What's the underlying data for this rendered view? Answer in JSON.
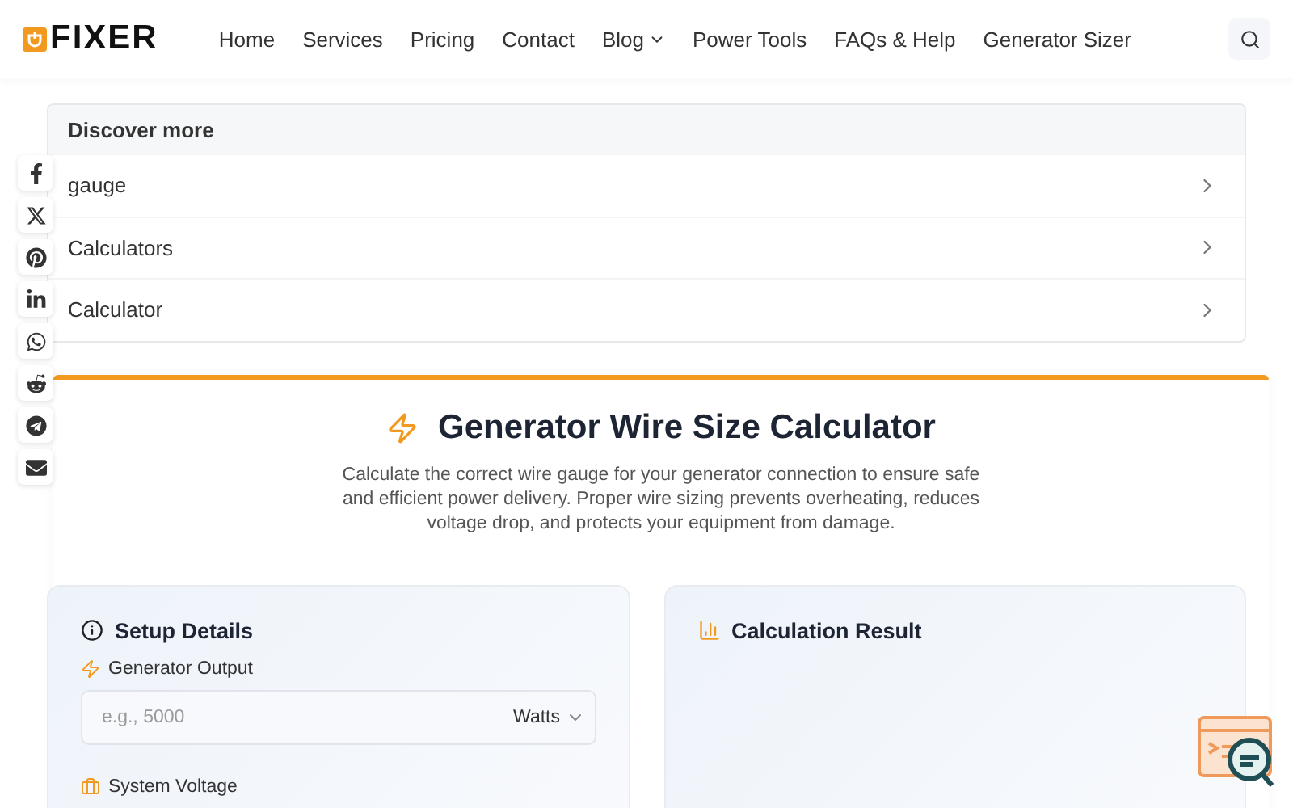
{
  "logo": {
    "text": "FIXER"
  },
  "nav": [
    {
      "label": "Home",
      "has_menu": false
    },
    {
      "label": "Services",
      "has_menu": false
    },
    {
      "label": "Pricing",
      "has_menu": false
    },
    {
      "label": "Contact",
      "has_menu": false
    },
    {
      "label": "Blog",
      "has_menu": true
    },
    {
      "label": "Power Tools",
      "has_menu": false
    },
    {
      "label": "FAQs & Help",
      "has_menu": false
    },
    {
      "label": "Generator Sizer",
      "has_menu": false
    }
  ],
  "discover": {
    "title": "Discover more",
    "items": [
      "gauge",
      "Calculators",
      "Calculator"
    ]
  },
  "share": [
    {
      "kind": "facebook"
    },
    {
      "kind": "x"
    },
    {
      "kind": "pinterest"
    },
    {
      "kind": "linkedin"
    },
    {
      "kind": "whatsapp"
    },
    {
      "kind": "reddit"
    },
    {
      "kind": "telegram"
    },
    {
      "kind": "email"
    }
  ],
  "calculator": {
    "title": "Generator Wire Size Calculator",
    "description": "Calculate the correct wire gauge for your generator connection to ensure safe and efficient power delivery. Proper wire sizing prevents overheating, reduces voltage drop, and protects your equipment from damage.",
    "setup": {
      "title": "Setup Details",
      "fields": [
        {
          "label": "Generator Output",
          "placeholder": "e.g., 5000",
          "unit": "Watts"
        },
        {
          "label": "System Voltage"
        }
      ]
    },
    "result": {
      "title": "Calculation Result"
    }
  }
}
